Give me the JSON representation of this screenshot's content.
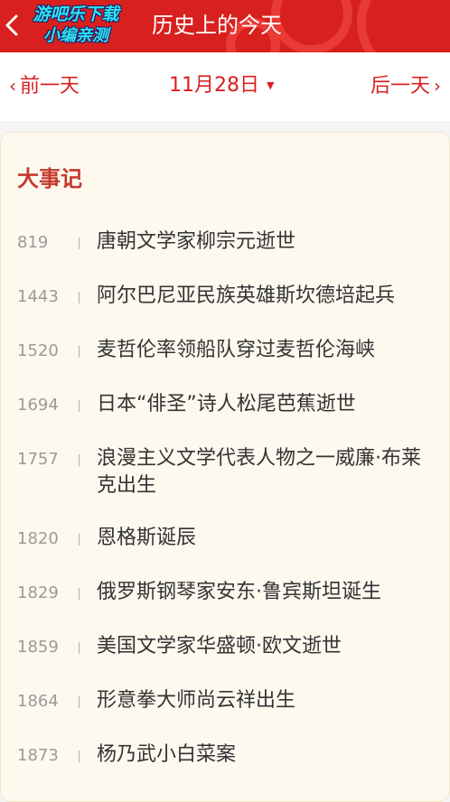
{
  "header": {
    "title": "历史上的今天",
    "watermark_line1": "游吧乐下载",
    "watermark_line2": "小编亲测",
    "bg_color": "#d8201f"
  },
  "date_nav": {
    "prev_label": "前一天",
    "date_label": "11月28日",
    "next_label": "后一天",
    "accent_color": "#d8201f"
  },
  "section": {
    "title": "大事记"
  },
  "events": [
    {
      "year": "819",
      "title": "唐朝文学家柳宗元逝世"
    },
    {
      "year": "1443",
      "title": "阿尔巴尼亚民族英雄斯坎德培起兵"
    },
    {
      "year": "1520",
      "title": "麦哲伦率领船队穿过麦哲伦海峡"
    },
    {
      "year": "1694",
      "title": "日本“俳圣”诗人松尾芭蕉逝世"
    },
    {
      "year": "1757",
      "title": "浪漫主义文学代表人物之一威廉·布莱克出生"
    },
    {
      "year": "1820",
      "title": "恩格斯诞辰"
    },
    {
      "year": "1829",
      "title": "俄罗斯钢琴家安东·鲁宾斯坦诞生"
    },
    {
      "year": "1859",
      "title": "美国文学家华盛顿·欧文逝世"
    },
    {
      "year": "1864",
      "title": "形意拳大师尚云祥出生"
    },
    {
      "year": "1873",
      "title": "杨乃武小白菜案"
    }
  ]
}
